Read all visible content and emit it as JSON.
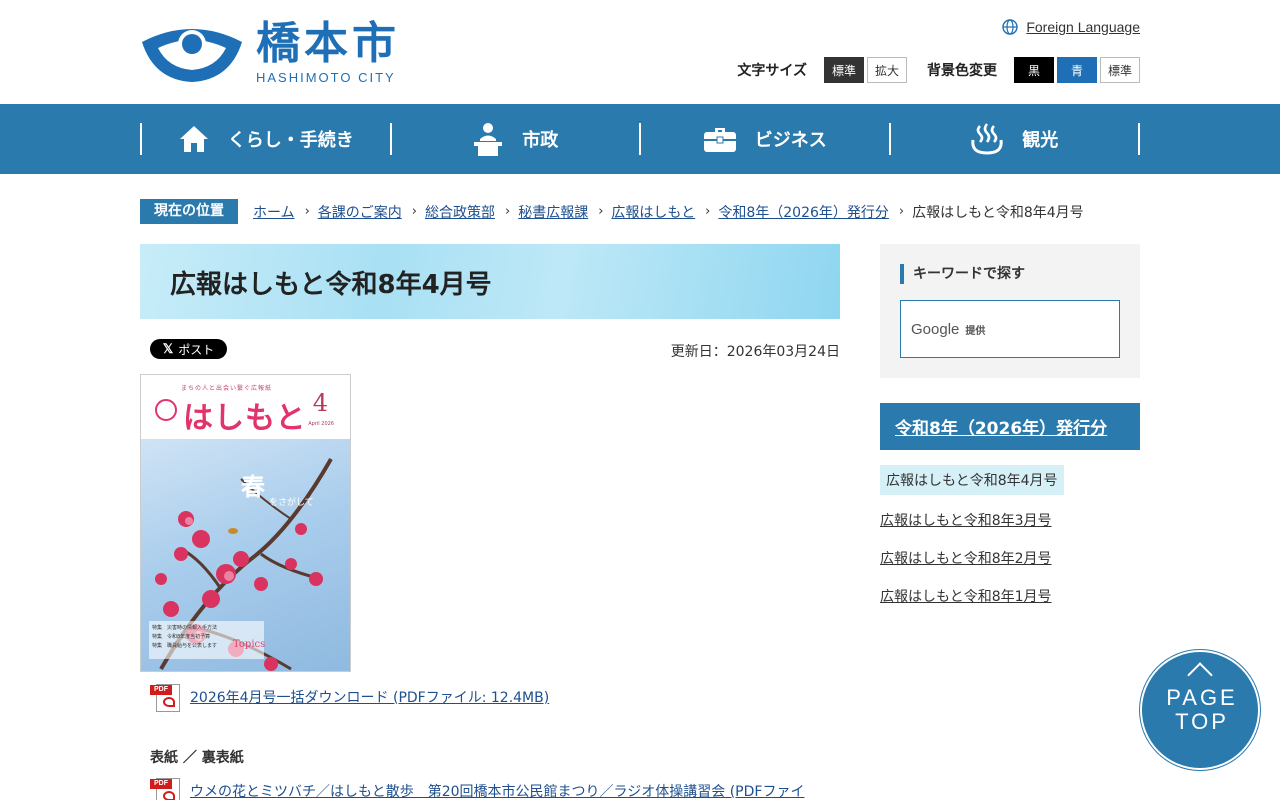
{
  "header": {
    "logo_ja": "橋本市",
    "logo_en": "HASHIMOTO CITY",
    "foreign_language": "Foreign Language",
    "text_size_label": "文字サイズ",
    "text_size_standard": "標準",
    "text_size_large": "拡大",
    "bg_color_label": "背景色変更",
    "bg_black": "黒",
    "bg_blue": "青",
    "bg_standard": "標準"
  },
  "nav": {
    "items": [
      {
        "label": "くらし・手続き",
        "icon": "house-icon"
      },
      {
        "label": "市政",
        "icon": "podium-speaker-icon"
      },
      {
        "label": "ビジネス",
        "icon": "briefcase-icon"
      },
      {
        "label": "観光",
        "icon": "hot-spring-icon"
      }
    ]
  },
  "breadcrumb": {
    "label": "現在の位置",
    "items": [
      "ホーム",
      "各課のご案内",
      "総合政策部",
      "秘書広報課",
      "広報はしもと",
      "令和8年（2026年）発行分"
    ],
    "current": "広報はしもと令和8年4月号"
  },
  "main": {
    "title": "広報はしもと令和8年4月号",
    "x_post": "ポスト",
    "x_logo": "𝕏",
    "updated": "更新日：2026年03月24日",
    "cover": {
      "tagline": "まちの人と出会い繋ぐ広報紙",
      "title": "はしもと",
      "number": "4",
      "date": "April 2026",
      "haru": "春",
      "haru_sub": "をさがして",
      "caption": [
        "特集　災害時の情報入手方法",
        "特集　令和8年度当初予算",
        "特集　職員給与を公表します"
      ],
      "topics": "Topics"
    },
    "pdf_icon_text": "PDF",
    "download_link": "2026年4月号一括ダウンロード (PDFファイル: 12.4MB)",
    "section_heading": "表紙 ／ 裏表紙",
    "item_link": "ウメの花とミツバチ／はしもと散歩　第20回橋本市公民館まつり／ラジオ体操講習会 (PDFファイ"
  },
  "sidebar": {
    "search_title": "キーワードで探す",
    "search_brand": "Google",
    "search_provided": "提供",
    "heading": "令和8年（2026年）発行分",
    "current_item": "広報はしもと令和8年4月号",
    "items": [
      "広報はしもと令和8年3月号",
      "広報はしもと令和8年2月号",
      "広報はしもと令和8年1月号"
    ]
  },
  "pagetop": {
    "line1": "PAGE",
    "line2": "TOP"
  },
  "colors": {
    "brand_blue": "#2a7aad",
    "logo_blue": "#1e6fb5",
    "link": "#1e4f8f"
  }
}
